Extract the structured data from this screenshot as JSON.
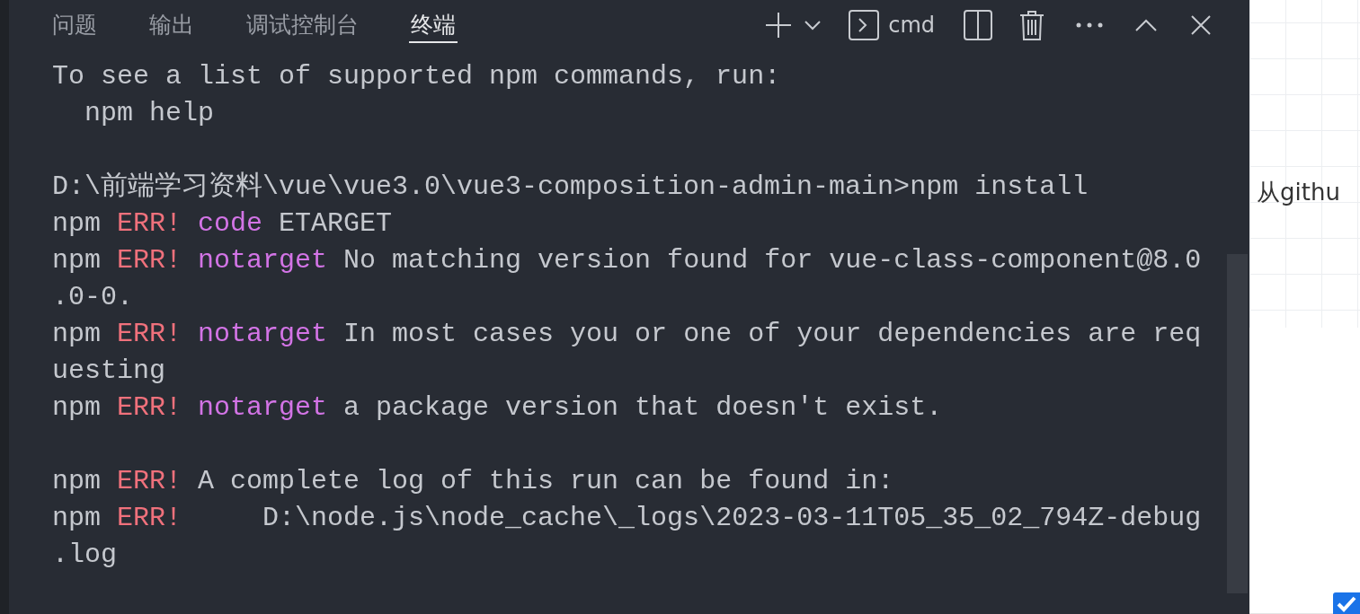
{
  "panel_tabs": [
    {
      "label": "问题",
      "selected": false
    },
    {
      "label": "输出",
      "selected": false
    },
    {
      "label": "调试控制台",
      "selected": false
    },
    {
      "label": "终端",
      "selected": true
    }
  ],
  "toolbar": {
    "shell_label": "cmd"
  },
  "terminal_lines": [
    {
      "kind": "output",
      "segments": [
        {
          "kind": "text",
          "text": "To see a list of supported npm commands, run:"
        }
      ]
    },
    {
      "kind": "output",
      "segments": [
        {
          "kind": "text",
          "text": "  npm help"
        }
      ]
    },
    {
      "kind": "blank"
    },
    {
      "kind": "output",
      "segments": [
        {
          "kind": "text",
          "text": "D:\\前端学习资料\\vue\\vue3.0\\vue3-composition-admin-main>npm install"
        }
      ]
    },
    {
      "kind": "output",
      "segments": [
        {
          "kind": "text",
          "text": "npm "
        },
        {
          "kind": "error",
          "text": "ERR!"
        },
        {
          "kind": "keyword",
          "text": " code"
        },
        {
          "kind": "text",
          "text": " ETARGET"
        }
      ]
    },
    {
      "kind": "output",
      "segments": [
        {
          "kind": "text",
          "text": "npm "
        },
        {
          "kind": "error",
          "text": "ERR!"
        },
        {
          "kind": "keyword",
          "text": " notarget"
        },
        {
          "kind": "text",
          "text": " No matching version found for vue-class-component@8.0"
        }
      ]
    },
    {
      "kind": "output",
      "segments": [
        {
          "kind": "text",
          "text": ".0-0."
        }
      ]
    },
    {
      "kind": "output",
      "segments": [
        {
          "kind": "text",
          "text": "npm "
        },
        {
          "kind": "error",
          "text": "ERR!"
        },
        {
          "kind": "keyword",
          "text": " notarget"
        },
        {
          "kind": "text",
          "text": " In most cases you or one of your dependencies are req"
        }
      ]
    },
    {
      "kind": "output",
      "segments": [
        {
          "kind": "text",
          "text": "uesting"
        }
      ]
    },
    {
      "kind": "output",
      "segments": [
        {
          "kind": "text",
          "text": "npm "
        },
        {
          "kind": "error",
          "text": "ERR!"
        },
        {
          "kind": "keyword",
          "text": " notarget"
        },
        {
          "kind": "text",
          "text": " a package version that doesn't exist."
        }
      ]
    },
    {
      "kind": "blank"
    },
    {
      "kind": "output",
      "segments": [
        {
          "kind": "text",
          "text": "npm "
        },
        {
          "kind": "error",
          "text": "ERR!"
        },
        {
          "kind": "text",
          "text": " A complete log of this run can be found in:"
        }
      ]
    },
    {
      "kind": "output",
      "segments": [
        {
          "kind": "text",
          "text": "npm "
        },
        {
          "kind": "error",
          "text": "ERR!"
        },
        {
          "kind": "text",
          "text": "     D:\\node.js\\node_cache\\_logs\\2023-03-11T05_35_02_794Z-debug"
        }
      ]
    },
    {
      "kind": "output",
      "segments": [
        {
          "kind": "text",
          "text": ".log"
        }
      ]
    }
  ],
  "side_document": {
    "text": "从githu",
    "checkbox": {
      "checked": true
    }
  }
}
